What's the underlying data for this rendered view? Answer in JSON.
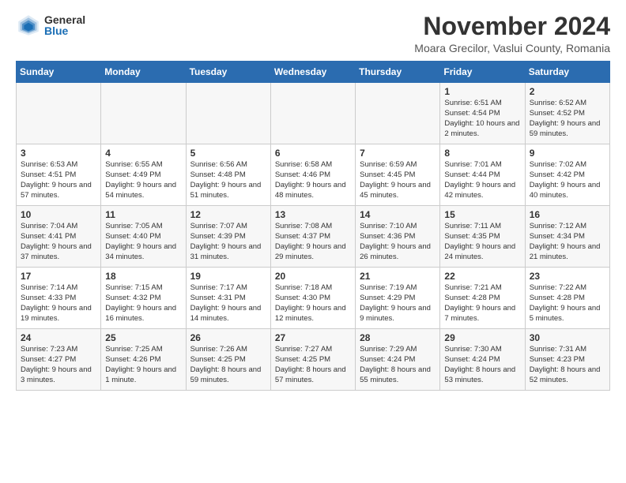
{
  "logo": {
    "general": "General",
    "blue": "Blue"
  },
  "title": {
    "month_year": "November 2024",
    "location": "Moara Grecilor, Vaslui County, Romania"
  },
  "weekdays": [
    "Sunday",
    "Monday",
    "Tuesday",
    "Wednesday",
    "Thursday",
    "Friday",
    "Saturday"
  ],
  "weeks": [
    [
      {
        "day": "",
        "info": ""
      },
      {
        "day": "",
        "info": ""
      },
      {
        "day": "",
        "info": ""
      },
      {
        "day": "",
        "info": ""
      },
      {
        "day": "",
        "info": ""
      },
      {
        "day": "1",
        "info": "Sunrise: 6:51 AM\nSunset: 4:54 PM\nDaylight: 10 hours and 2 minutes."
      },
      {
        "day": "2",
        "info": "Sunrise: 6:52 AM\nSunset: 4:52 PM\nDaylight: 9 hours and 59 minutes."
      }
    ],
    [
      {
        "day": "3",
        "info": "Sunrise: 6:53 AM\nSunset: 4:51 PM\nDaylight: 9 hours and 57 minutes."
      },
      {
        "day": "4",
        "info": "Sunrise: 6:55 AM\nSunset: 4:49 PM\nDaylight: 9 hours and 54 minutes."
      },
      {
        "day": "5",
        "info": "Sunrise: 6:56 AM\nSunset: 4:48 PM\nDaylight: 9 hours and 51 minutes."
      },
      {
        "day": "6",
        "info": "Sunrise: 6:58 AM\nSunset: 4:46 PM\nDaylight: 9 hours and 48 minutes."
      },
      {
        "day": "7",
        "info": "Sunrise: 6:59 AM\nSunset: 4:45 PM\nDaylight: 9 hours and 45 minutes."
      },
      {
        "day": "8",
        "info": "Sunrise: 7:01 AM\nSunset: 4:44 PM\nDaylight: 9 hours and 42 minutes."
      },
      {
        "day": "9",
        "info": "Sunrise: 7:02 AM\nSunset: 4:42 PM\nDaylight: 9 hours and 40 minutes."
      }
    ],
    [
      {
        "day": "10",
        "info": "Sunrise: 7:04 AM\nSunset: 4:41 PM\nDaylight: 9 hours and 37 minutes."
      },
      {
        "day": "11",
        "info": "Sunrise: 7:05 AM\nSunset: 4:40 PM\nDaylight: 9 hours and 34 minutes."
      },
      {
        "day": "12",
        "info": "Sunrise: 7:07 AM\nSunset: 4:39 PM\nDaylight: 9 hours and 31 minutes."
      },
      {
        "day": "13",
        "info": "Sunrise: 7:08 AM\nSunset: 4:37 PM\nDaylight: 9 hours and 29 minutes."
      },
      {
        "day": "14",
        "info": "Sunrise: 7:10 AM\nSunset: 4:36 PM\nDaylight: 9 hours and 26 minutes."
      },
      {
        "day": "15",
        "info": "Sunrise: 7:11 AM\nSunset: 4:35 PM\nDaylight: 9 hours and 24 minutes."
      },
      {
        "day": "16",
        "info": "Sunrise: 7:12 AM\nSunset: 4:34 PM\nDaylight: 9 hours and 21 minutes."
      }
    ],
    [
      {
        "day": "17",
        "info": "Sunrise: 7:14 AM\nSunset: 4:33 PM\nDaylight: 9 hours and 19 minutes."
      },
      {
        "day": "18",
        "info": "Sunrise: 7:15 AM\nSunset: 4:32 PM\nDaylight: 9 hours and 16 minutes."
      },
      {
        "day": "19",
        "info": "Sunrise: 7:17 AM\nSunset: 4:31 PM\nDaylight: 9 hours and 14 minutes."
      },
      {
        "day": "20",
        "info": "Sunrise: 7:18 AM\nSunset: 4:30 PM\nDaylight: 9 hours and 12 minutes."
      },
      {
        "day": "21",
        "info": "Sunrise: 7:19 AM\nSunset: 4:29 PM\nDaylight: 9 hours and 9 minutes."
      },
      {
        "day": "22",
        "info": "Sunrise: 7:21 AM\nSunset: 4:28 PM\nDaylight: 9 hours and 7 minutes."
      },
      {
        "day": "23",
        "info": "Sunrise: 7:22 AM\nSunset: 4:28 PM\nDaylight: 9 hours and 5 minutes."
      }
    ],
    [
      {
        "day": "24",
        "info": "Sunrise: 7:23 AM\nSunset: 4:27 PM\nDaylight: 9 hours and 3 minutes."
      },
      {
        "day": "25",
        "info": "Sunrise: 7:25 AM\nSunset: 4:26 PM\nDaylight: 9 hours and 1 minute."
      },
      {
        "day": "26",
        "info": "Sunrise: 7:26 AM\nSunset: 4:25 PM\nDaylight: 8 hours and 59 minutes."
      },
      {
        "day": "27",
        "info": "Sunrise: 7:27 AM\nSunset: 4:25 PM\nDaylight: 8 hours and 57 minutes."
      },
      {
        "day": "28",
        "info": "Sunrise: 7:29 AM\nSunset: 4:24 PM\nDaylight: 8 hours and 55 minutes."
      },
      {
        "day": "29",
        "info": "Sunrise: 7:30 AM\nSunset: 4:24 PM\nDaylight: 8 hours and 53 minutes."
      },
      {
        "day": "30",
        "info": "Sunrise: 7:31 AM\nSunset: 4:23 PM\nDaylight: 8 hours and 52 minutes."
      }
    ]
  ]
}
